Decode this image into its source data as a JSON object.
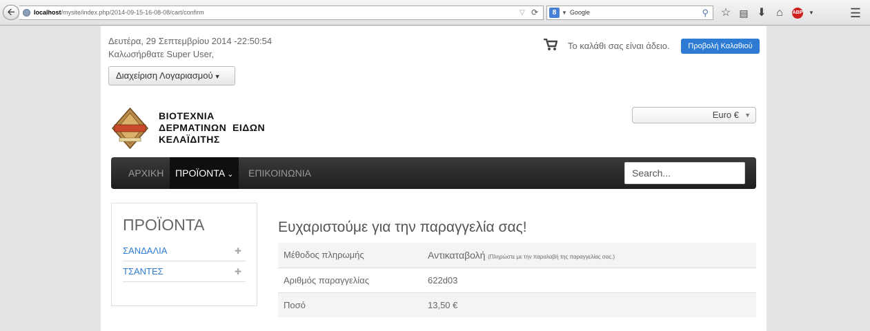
{
  "browser": {
    "url_host": "localhost",
    "url_path": "/mysite/index.php/2014-09-15-16-08-08/cart/confirm",
    "search_engine": "Google",
    "abp_label": "ABP"
  },
  "header": {
    "date_line": "Δευτέρα, 29 Σεπτεμβρίου 2014 -22:50:54",
    "welcome_line": "Καλωσήρθατε Super User,",
    "account_button": "Διαχείριση Λογαριασμού",
    "cart_status": "Το καλάθι σας είναι άδειο.",
    "cart_button": "Προβολή Καλαθιού"
  },
  "logo": {
    "lines": [
      "ΒΙΟΤΕΧΝΙΑ",
      "ΔΕΡΜΑΤΙΝΩΝ  ΕΙΔΩΝ",
      "ΚΕΛΑΪΔΙΤΗΣ"
    ]
  },
  "currency": {
    "selected": "Euro €"
  },
  "nav": {
    "items": [
      {
        "label": "ΑΡΧΙΚΗ"
      },
      {
        "label": "ΠΡΟΪΟΝΤΑ"
      },
      {
        "label": "ΕΠΙΚΟΙΝΩΝΙΑ"
      }
    ],
    "search_placeholder": "Search..."
  },
  "sidebar": {
    "title": "ΠΡΟΪΟΝΤΑ",
    "items": [
      {
        "label": "ΣΑΝΔΑΛΙΑ"
      },
      {
        "label": "ΤΣΑΝΤΕΣ"
      }
    ]
  },
  "order": {
    "title": "Ευχαριστούμε για την παραγγελία σας!",
    "rows": [
      {
        "label": "Μέθοδος πληρωμής",
        "value": "Αντικαταβολή",
        "note": "(Πληρώστε με την παραλαβή της παραγγελίας σας.)"
      },
      {
        "label": "Αριθμός παραγγελίας",
        "value": "622d03"
      },
      {
        "label": "Ποσό",
        "value": "13,50 €"
      }
    ]
  },
  "colors": {
    "accent": "#2d7bd2",
    "navbar": "#2a2a2a"
  }
}
